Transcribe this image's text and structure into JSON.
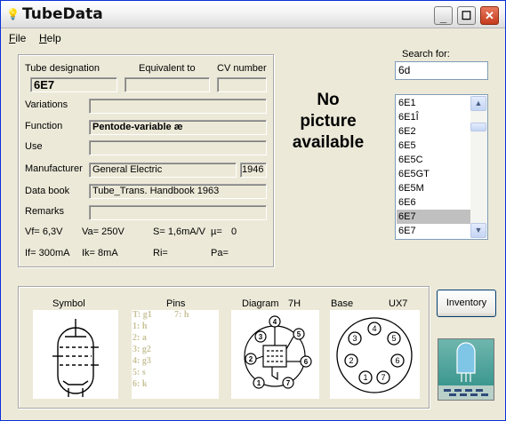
{
  "window": {
    "title": "TubeData"
  },
  "menu": [
    {
      "accel": "F",
      "rest": "ile"
    },
    {
      "accel": "H",
      "rest": "elp"
    }
  ],
  "labels": {
    "tube_designation": "Tube designation",
    "equivalent_to": "Equivalent to",
    "cv_number": "CV number",
    "variations": "Variations",
    "function": "Function",
    "use": "Use",
    "manufacturer": "Manufacturer",
    "data_book": "Data book",
    "remarks": "Remarks"
  },
  "values": {
    "tube_designation": "6E7",
    "equivalent_to": "",
    "cv_number": "",
    "variations": "",
    "function": "Pentode-variable æ",
    "use": "",
    "manufacturer": "General Electric",
    "year": "1946",
    "data_book": "Tube_Trans. Handbook 1963",
    "remarks": ""
  },
  "specs": {
    "vf": "Vf= 6,3V",
    "va": "Va= 250V",
    "s": "S= 1,6mA/V",
    "mu": "µ=",
    "mu_val": "0",
    "if": "If= 300mA",
    "ik": "Ik= 8mA",
    "ri": "Ri=",
    "pa": "Pa="
  },
  "picture": {
    "line1": "No",
    "line2": "picture",
    "line3": "available"
  },
  "search": {
    "label": "Search for:",
    "value": "6d"
  },
  "tube_list": {
    "items": [
      "6E1",
      "6E1Î",
      "6E2",
      "6E5",
      "6E5C",
      "6E5GT",
      "6E5M",
      "6E6",
      "6E7",
      "6E7"
    ],
    "selected_index": 8
  },
  "bottom": {
    "symbol": "Symbol",
    "pins": "Pins",
    "diagram": "Diagram",
    "diagram_code": "7H",
    "base": "Base",
    "base_code": "UX7"
  },
  "pins_list": [
    {
      "left": "T: g1",
      "right": "7: h"
    },
    {
      "left": "1: h",
      "right": ""
    },
    {
      "left": "2: a",
      "right": ""
    },
    {
      "left": "3: g2",
      "right": ""
    },
    {
      "left": "4: g3",
      "right": ""
    },
    {
      "left": "5: s",
      "right": ""
    },
    {
      "left": "6: k",
      "right": ""
    }
  ],
  "inventory_button": "Inventory",
  "colors": {
    "window_bg": "#ece9d8",
    "selection": "#c0c0c0",
    "border_blue": "#7f9db9"
  }
}
